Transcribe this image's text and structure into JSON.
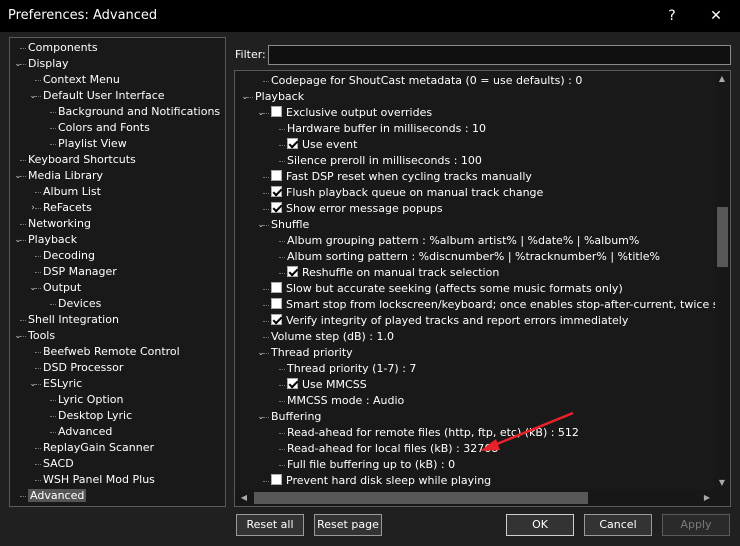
{
  "window": {
    "title": "Preferences: Advanced",
    "help_label": "?",
    "close_label": "✕"
  },
  "tree": [
    {
      "label": "Components",
      "level": 0,
      "expander": ""
    },
    {
      "label": "Display",
      "level": 0,
      "expander": "v"
    },
    {
      "label": "Context Menu",
      "level": 1,
      "expander": ""
    },
    {
      "label": "Default User Interface",
      "level": 1,
      "expander": "v"
    },
    {
      "label": "Background and Notifications",
      "level": 2,
      "expander": ""
    },
    {
      "label": "Colors and Fonts",
      "level": 2,
      "expander": ""
    },
    {
      "label": "Playlist View",
      "level": 2,
      "expander": ""
    },
    {
      "label": "Keyboard Shortcuts",
      "level": 0,
      "expander": ""
    },
    {
      "label": "Media Library",
      "level": 0,
      "expander": "v"
    },
    {
      "label": "Album List",
      "level": 1,
      "expander": ""
    },
    {
      "label": "ReFacets",
      "level": 1,
      "expander": ">"
    },
    {
      "label": "Networking",
      "level": 0,
      "expander": ""
    },
    {
      "label": "Playback",
      "level": 0,
      "expander": "v"
    },
    {
      "label": "Decoding",
      "level": 1,
      "expander": ""
    },
    {
      "label": "DSP Manager",
      "level": 1,
      "expander": ""
    },
    {
      "label": "Output",
      "level": 1,
      "expander": "v"
    },
    {
      "label": "Devices",
      "level": 2,
      "expander": ""
    },
    {
      "label": "Shell Integration",
      "level": 0,
      "expander": ""
    },
    {
      "label": "Tools",
      "level": 0,
      "expander": "v"
    },
    {
      "label": "Beefweb Remote Control",
      "level": 1,
      "expander": ""
    },
    {
      "label": "DSD Processor",
      "level": 1,
      "expander": ""
    },
    {
      "label": "ESLyric",
      "level": 1,
      "expander": "v"
    },
    {
      "label": "Lyric Option",
      "level": 2,
      "expander": ""
    },
    {
      "label": "Desktop Lyric",
      "level": 2,
      "expander": ""
    },
    {
      "label": "Advanced",
      "level": 2,
      "expander": ""
    },
    {
      "label": "ReplayGain Scanner",
      "level": 1,
      "expander": ""
    },
    {
      "label": "SACD",
      "level": 1,
      "expander": ""
    },
    {
      "label": "WSH Panel Mod Plus",
      "level": 1,
      "expander": ""
    },
    {
      "label": "Advanced",
      "level": 0,
      "expander": "",
      "selected": true
    }
  ],
  "filter": {
    "label": "Filter:",
    "value": ""
  },
  "advanced": [
    {
      "label": "Codepage for ShoutCast metadata (0 = use defaults) : 0",
      "level": 1,
      "type": "text",
      "expander": ""
    },
    {
      "label": "Playback",
      "level": 0,
      "type": "branch",
      "expander": "v"
    },
    {
      "label": "Exclusive output overrides",
      "level": 1,
      "type": "check",
      "checked": false,
      "expander": "v"
    },
    {
      "label": "Hardware buffer in milliseconds : 10",
      "level": 2,
      "type": "text",
      "expander": ""
    },
    {
      "label": "Use event",
      "level": 2,
      "type": "check",
      "checked": true,
      "expander": ""
    },
    {
      "label": "Silence preroll in milliseconds : 100",
      "level": 2,
      "type": "text",
      "expander": ""
    },
    {
      "label": "Fast DSP reset when cycling tracks manually",
      "level": 1,
      "type": "check",
      "checked": false,
      "expander": ""
    },
    {
      "label": "Flush playback queue on manual track change",
      "level": 1,
      "type": "check",
      "checked": true,
      "expander": ""
    },
    {
      "label": "Show error message popups",
      "level": 1,
      "type": "check",
      "checked": true,
      "expander": ""
    },
    {
      "label": "Shuffle",
      "level": 1,
      "type": "branch",
      "expander": "v"
    },
    {
      "label": "Album grouping pattern : %album artist% | %date% | %album%",
      "level": 2,
      "type": "text",
      "expander": ""
    },
    {
      "label": "Album sorting pattern : %discnumber% | %tracknumber% | %title%",
      "level": 2,
      "type": "text",
      "expander": ""
    },
    {
      "label": "Reshuffle on manual track selection",
      "level": 2,
      "type": "check",
      "checked": true,
      "expander": ""
    },
    {
      "label": "Slow but accurate seeking (affects some music formats only)",
      "level": 1,
      "type": "check",
      "checked": false,
      "expander": ""
    },
    {
      "label": "Smart stop from lockscreen/keyboard; once enables stop-after-current, twice stops",
      "level": 1,
      "type": "check",
      "checked": false,
      "expander": ""
    },
    {
      "label": "Verify integrity of played tracks and report errors immediately",
      "level": 1,
      "type": "check",
      "checked": true,
      "expander": ""
    },
    {
      "label": "Volume step (dB) : 1.0",
      "level": 1,
      "type": "text",
      "expander": ""
    },
    {
      "label": "Thread priority",
      "level": 1,
      "type": "branch",
      "expander": "v"
    },
    {
      "label": "Thread priority (1-7) : 7",
      "level": 2,
      "type": "text",
      "expander": ""
    },
    {
      "label": "Use MMCSS",
      "level": 2,
      "type": "check",
      "checked": true,
      "expander": ""
    },
    {
      "label": "MMCSS mode : Audio",
      "level": 2,
      "type": "text",
      "expander": ""
    },
    {
      "label": "Buffering",
      "level": 1,
      "type": "branch",
      "expander": "v"
    },
    {
      "label": "Read-ahead for remote files (http, ftp, etc) (kB) : 512",
      "level": 2,
      "type": "text",
      "expander": ""
    },
    {
      "label": "Read-ahead for local files (kB) : 32768",
      "level": 2,
      "type": "text",
      "expander": ""
    },
    {
      "label": "Full file buffering up to (kB) : 0",
      "level": 2,
      "type": "text",
      "expander": ""
    },
    {
      "label": "Prevent hard disk sleep while playing",
      "level": 1,
      "type": "check",
      "checked": false,
      "expander": ""
    }
  ],
  "buttons": {
    "reset_all": "Reset all",
    "reset_page": "Reset page",
    "ok": "OK",
    "cancel": "Cancel",
    "apply": "Apply"
  },
  "colors": {
    "annotation_arrow": "#e8222b",
    "selection": "#555555"
  }
}
